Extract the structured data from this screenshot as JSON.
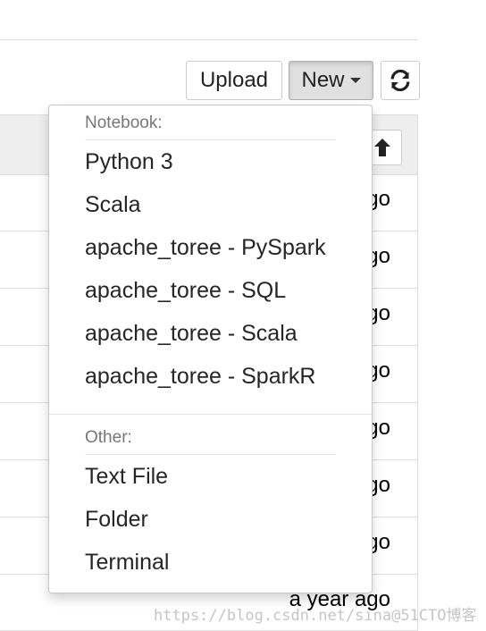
{
  "toolbar": {
    "upload_label": "Upload",
    "new_label": "New",
    "refresh_icon": "refresh-icon"
  },
  "file_list": {
    "sort_icon": "arrow-up-icon",
    "rows": [
      {
        "modified": "ago"
      },
      {
        "modified": "ago"
      },
      {
        "modified": "ago"
      },
      {
        "modified": "ago"
      },
      {
        "modified": "ago"
      },
      {
        "modified": "ago"
      },
      {
        "modified": "ago"
      },
      {
        "modified": "a year ago"
      }
    ]
  },
  "new_menu": {
    "notebook_header": "Notebook:",
    "notebook_items": [
      "Python 3",
      "Scala",
      "apache_toree - PySpark",
      "apache_toree - SQL",
      "apache_toree - Scala",
      "apache_toree - SparkR"
    ],
    "other_header": "Other:",
    "other_items": [
      "Text File",
      "Folder",
      "Terminal"
    ]
  },
  "watermark": "https://blog.csdn.net/sina@51CTO博客"
}
